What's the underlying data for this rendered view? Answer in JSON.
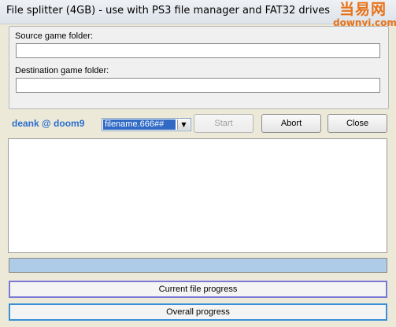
{
  "window": {
    "title": "File splitter (4GB) - use with PS3 file manager and FAT32 drives",
    "watermark": {
      "top": "当易网",
      "bottom": "downyi.com"
    }
  },
  "form": {
    "source_label": "Source game folder:",
    "source_value": "",
    "dest_label": "Destination game folder:",
    "dest_value": ""
  },
  "controls": {
    "author": "deank @ doom9",
    "naming_select": "filename.666##",
    "start_label": "Start",
    "abort_label": "Abort",
    "close_label": "Close",
    "start_enabled": false
  },
  "progress": {
    "current_label": "Current file progress",
    "current_value": 0,
    "overall_label": "Overall progress",
    "overall_value": 0
  },
  "colors": {
    "author": "#2a6ecf",
    "selection": "#316ac5",
    "progress_border": "#7a7ad6",
    "overall_border": "#3a8fd8",
    "watermark": "#e8731a"
  }
}
